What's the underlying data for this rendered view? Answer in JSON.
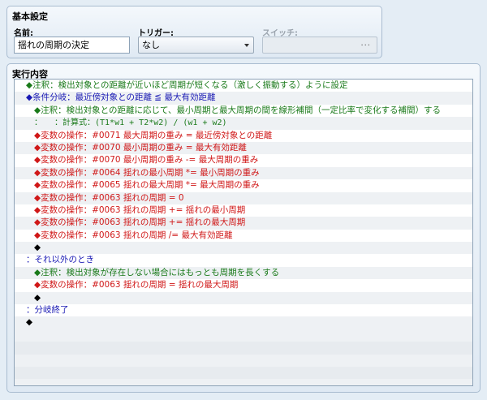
{
  "basic": {
    "title": "基本設定",
    "name_label": "名前:",
    "name_value": "揺れの周期の決定",
    "trigger_label": "トリガー:",
    "trigger_value": "なし",
    "switch_label": "スイッチ:",
    "switch_dots": "..."
  },
  "content": {
    "title": "実行内容",
    "rows": [
      {
        "indent": 0,
        "color": "#1a7a1a",
        "text": "◆注釈：検出対象との距離が近いほど周期が短くなる（激しく振動する）ように設定"
      },
      {
        "indent": 0,
        "color": "#1a1ab4",
        "text": "◆条件分岐：最近傍対象との距離 ≦ 最大有効距離"
      },
      {
        "indent": 1,
        "color": "#1a7a1a",
        "text": "◆注釈：検出対象との距離に応じて、最小周期と最大周期の間を線形補間（一定比率で変化する補間）する"
      },
      {
        "indent": 1,
        "color": "#1a7a1a",
        "text": "：　　：計算式：(T1*w1 + T2*w2) / (w1 + w2)",
        "mono": true
      },
      {
        "indent": 1,
        "color": "#d01818",
        "text": "◆変数の操作：#0071 最大周期の重み = 最近傍対象との距離"
      },
      {
        "indent": 1,
        "color": "#d01818",
        "text": "◆変数の操作：#0070 最小周期の重み = 最大有効距離"
      },
      {
        "indent": 1,
        "color": "#d01818",
        "text": "◆変数の操作：#0070 最小周期の重み -= 最大周期の重み"
      },
      {
        "indent": 1,
        "color": "#d01818",
        "text": "◆変数の操作：#0064 揺れの最小周期 *= 最小周期の重み"
      },
      {
        "indent": 1,
        "color": "#d01818",
        "text": "◆変数の操作：#0065 揺れの最大周期 *= 最大周期の重み"
      },
      {
        "indent": 1,
        "color": "#d01818",
        "text": "◆変数の操作：#0063 揺れの周期 = 0"
      },
      {
        "indent": 1,
        "color": "#d01818",
        "text": "◆変数の操作：#0063 揺れの周期 += 揺れの最小周期"
      },
      {
        "indent": 1,
        "color": "#d01818",
        "text": "◆変数の操作：#0063 揺れの周期 += 揺れの最大周期"
      },
      {
        "indent": 1,
        "color": "#d01818",
        "text": "◆変数の操作：#0063 揺れの周期 /= 最大有効距離"
      },
      {
        "indent": 1,
        "color": "#000000",
        "text": "◆"
      },
      {
        "indent": 0,
        "color": "#1a1ab4",
        "text": "：それ以外のとき"
      },
      {
        "indent": 1,
        "color": "#1a7a1a",
        "text": "◆注釈：検出対象が存在しない場合にはもっとも周期を長くする"
      },
      {
        "indent": 1,
        "color": "#d01818",
        "text": "◆変数の操作：#0063 揺れの周期 = 揺れの最大周期"
      },
      {
        "indent": 1,
        "color": "#000000",
        "text": "◆"
      },
      {
        "indent": 0,
        "color": "#1a1ab4",
        "text": "：分岐終了"
      },
      {
        "indent": 0,
        "color": "#000000",
        "text": "◆"
      }
    ],
    "empty_rows": 5
  }
}
